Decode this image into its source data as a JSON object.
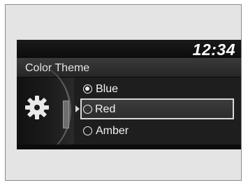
{
  "header": {
    "clock": "12:34"
  },
  "screen": {
    "title": "Color Theme"
  },
  "options": [
    {
      "label": "Blue",
      "checked": true
    },
    {
      "label": "Red",
      "checked": false
    },
    {
      "label": "Amber",
      "checked": false
    }
  ],
  "highlighted_option": "Red",
  "icons": {
    "settings": "gear-icon"
  }
}
